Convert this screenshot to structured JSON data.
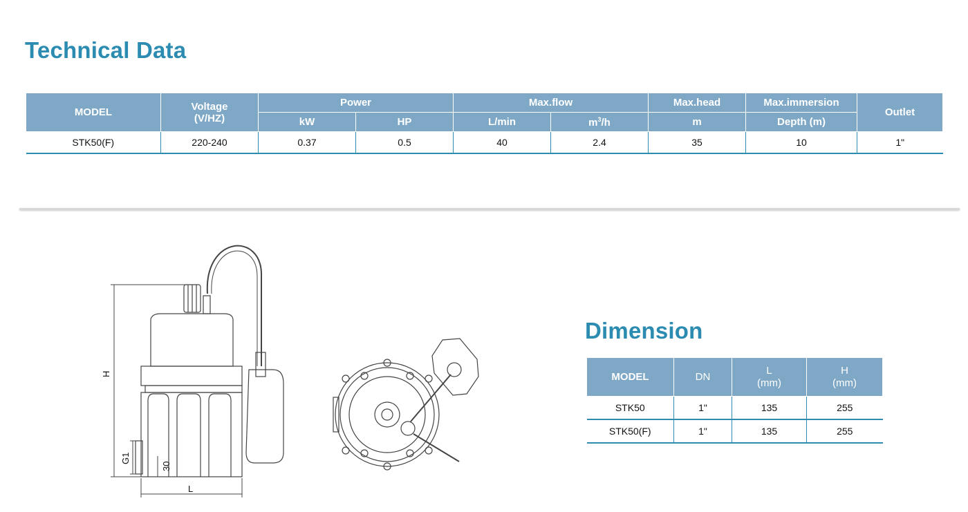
{
  "tech": {
    "title": "Technical Data",
    "headers": {
      "model": "MODEL",
      "voltage_line1": "Voltage",
      "voltage_line2": "(V/HZ)",
      "power": "Power",
      "maxflow": "Max.flow",
      "maxhead": "Max.head",
      "maxim": "Max.immersion",
      "outlet": "Outlet",
      "kw": "kW",
      "hp": "HP",
      "lmin": "L/min",
      "m3h_base": "m",
      "m3h_sup": "3",
      "m3h_tail": "/h",
      "m": "m",
      "depth": "Depth (m)"
    },
    "row": {
      "model": "STK50(F)",
      "voltage": "220-240",
      "kw": "0.37",
      "hp": "0.5",
      "lmin": "40",
      "m3h": "2.4",
      "head": "35",
      "depth": "10",
      "outlet": "1\""
    }
  },
  "dimension": {
    "title": "Dimension",
    "headers": {
      "model": "MODEL",
      "dn": "DN",
      "l1": "L",
      "l2": "(mm)",
      "h1": "H",
      "h2": "(mm)"
    },
    "rows": [
      {
        "model": "STK50",
        "dn": "1\"",
        "l": "135",
        "h": "255"
      },
      {
        "model": "STK50(F)",
        "dn": "1\"",
        "l": "135",
        "h": "255"
      }
    ]
  },
  "drawing": {
    "labels": {
      "h": "H",
      "l": "L",
      "g1": "G1",
      "thirty": "30"
    }
  },
  "colors": {
    "accent": "#2b8bb0",
    "header_bg": "#7ea8c6"
  }
}
